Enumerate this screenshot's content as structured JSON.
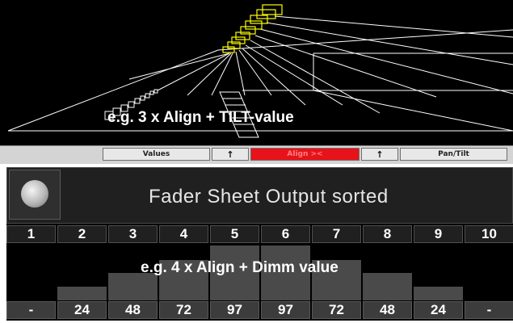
{
  "stage": {
    "caption": "e.g. 3 x Align + TILT-value",
    "line_color": "#ffffff",
    "fixture_color": "#ffff00"
  },
  "toolbar": {
    "buttons": [
      {
        "label": "Values",
        "active": false
      },
      {
        "label": "↑",
        "kind": "up-arrow-icon"
      },
      {
        "label": "Align ><",
        "active": true
      },
      {
        "label": "↑",
        "kind": "up-arrow-icon"
      },
      {
        "label": "Pan/Tilt",
        "active": false
      }
    ],
    "active_color": "#e8121a"
  },
  "fader_sheet": {
    "title": "Fader Sheet  Output   sorted",
    "caption": "e.g. 4 x Align + Dimm value",
    "channels": [
      {
        "number": "1",
        "value": "-",
        "level": 0
      },
      {
        "number": "2",
        "value": "24",
        "level": 0.24
      },
      {
        "number": "3",
        "value": "48",
        "level": 0.48
      },
      {
        "number": "4",
        "value": "72",
        "level": 0.72
      },
      {
        "number": "5",
        "value": "97",
        "level": 0.97
      },
      {
        "number": "6",
        "value": "97",
        "level": 0.97
      },
      {
        "number": "7",
        "value": "72",
        "level": 0.72
      },
      {
        "number": "8",
        "value": "48",
        "level": 0.48
      },
      {
        "number": "9",
        "value": "24",
        "level": 0.24
      },
      {
        "number": "10",
        "value": "-",
        "level": 0
      }
    ]
  }
}
